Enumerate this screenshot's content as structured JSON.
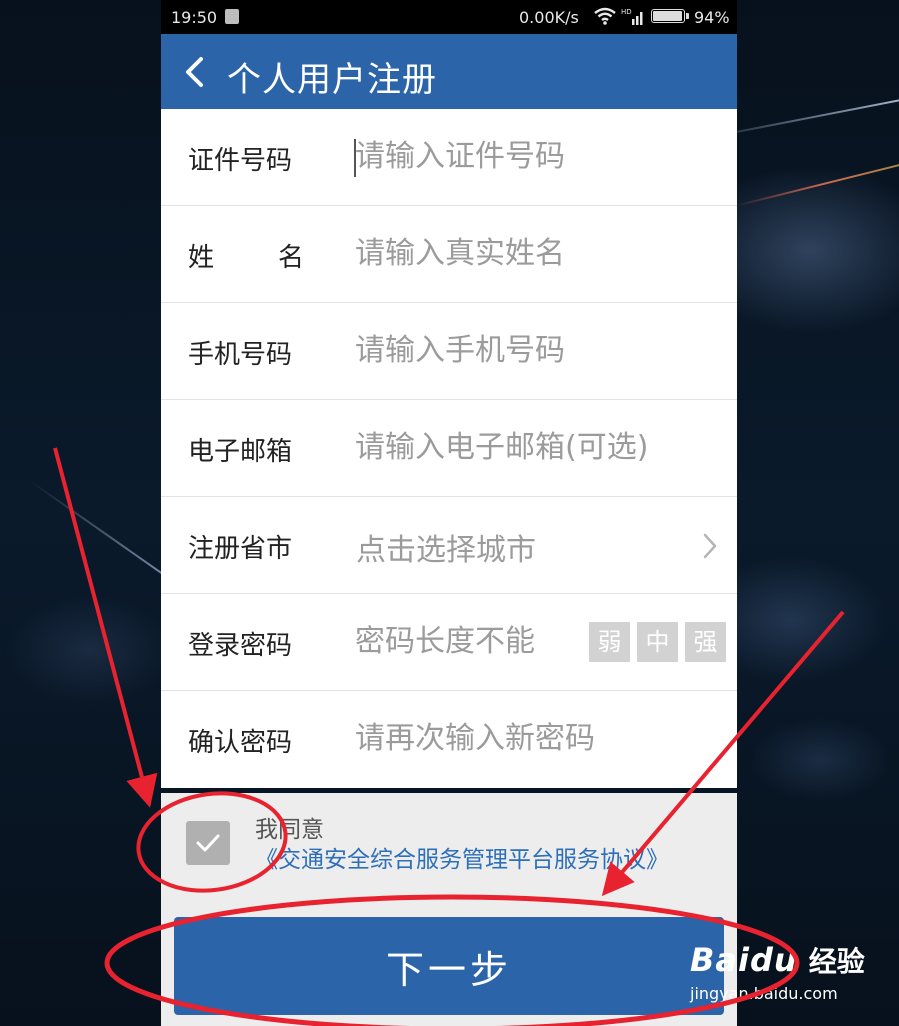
{
  "status_bar": {
    "time": "19:50",
    "net_speed": "0.00K/s",
    "network_label": "HD",
    "battery_level": 0.94,
    "battery_percent": "94%"
  },
  "header": {
    "back_icon": "chevron-left-icon",
    "title": "个人用户注册"
  },
  "form": {
    "id_number": {
      "label": "证件号码",
      "placeholder": "请输入证件号码"
    },
    "name": {
      "label_parts": [
        "姓",
        "名"
      ],
      "placeholder": "请输入真实姓名"
    },
    "phone": {
      "label": "手机号码",
      "placeholder": "请输入手机号码"
    },
    "email": {
      "label": "电子邮箱",
      "placeholder": "请输入电子邮箱(可选)"
    },
    "city": {
      "label": "注册省市",
      "placeholder": "点击选择城市",
      "icon": "chevron-right-icon"
    },
    "password": {
      "label": "登录密码",
      "placeholder": "密码长度不能",
      "strength": [
        "弱",
        "中",
        "强"
      ]
    },
    "confirm_password": {
      "label": "确认密码",
      "placeholder": "请再次输入新密码"
    }
  },
  "agreement": {
    "checked": true,
    "prefix": "我同意",
    "link_text": "《交通安全综合服务管理平台服务协议》"
  },
  "next_button": {
    "label": "下一步"
  },
  "watermark": {
    "brand": "Bai",
    "brand_suffix": "du",
    "product": "经验",
    "url": "jingyan.baidu.com"
  },
  "colors": {
    "primary": "#2b64a9",
    "link": "#2d6fb8",
    "annotation": "#e8232f",
    "strength_inactive": "#d2d2d2"
  }
}
